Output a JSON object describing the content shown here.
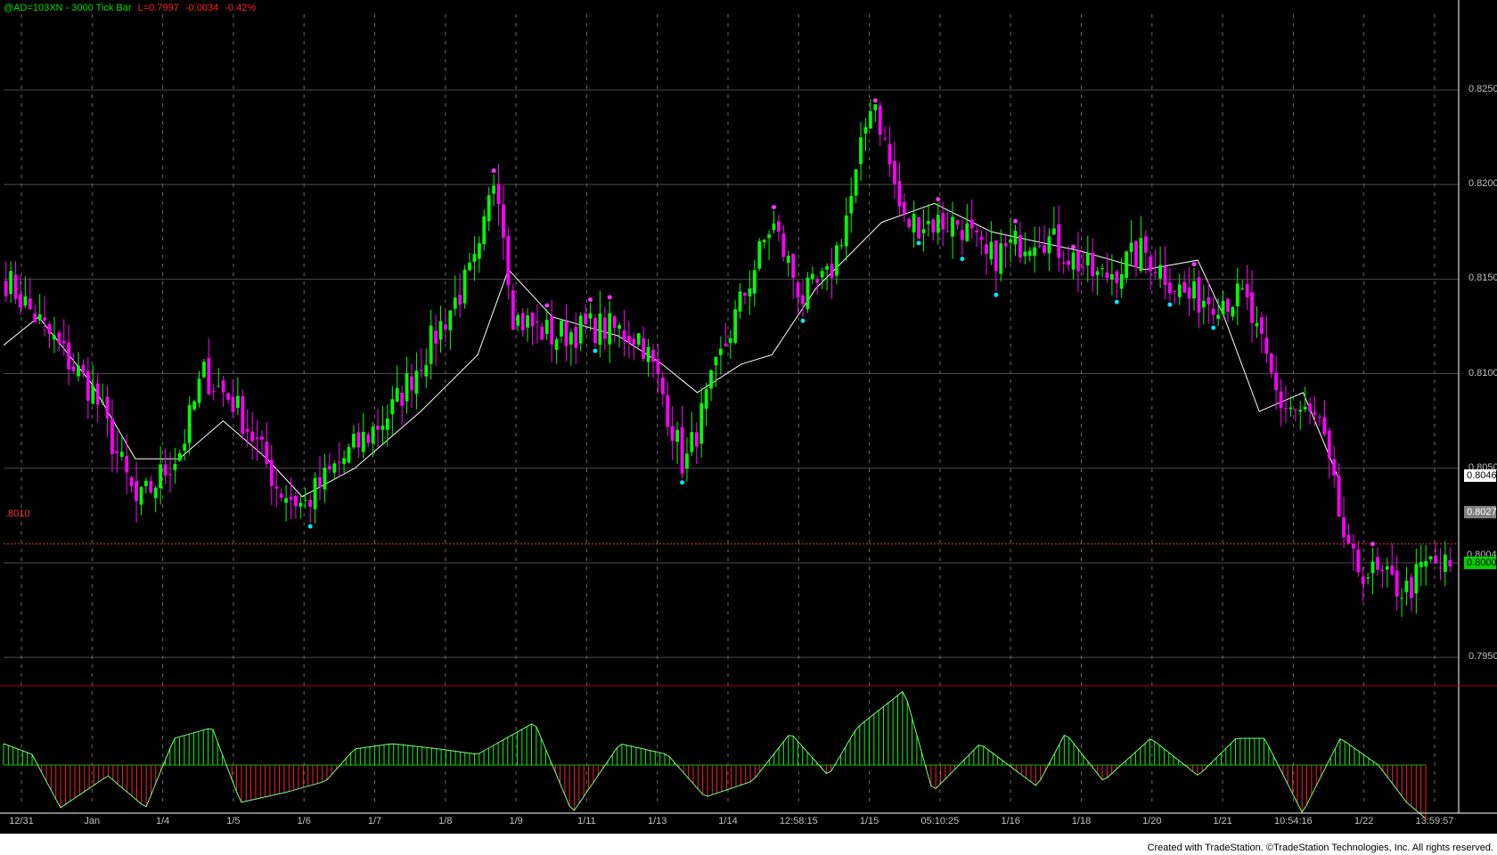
{
  "header": {
    "symbol": "@AD=103XN",
    "interval": "3000 Tick Bar",
    "last": "L=0.7997",
    "change": "-0.0034",
    "pct": "-0.42%"
  },
  "footer": "Created with TradeStation. ©TradeStation Technologies, Inc. All rights reserved.",
  "ref_line_label": ".8010",
  "price_tags": [
    {
      "text": "0.8046",
      "bg": "#ffffff",
      "fg": "#000000",
      "price": 0.8046
    },
    {
      "text": "0.8027",
      "bg": "#808080",
      "fg": "#ffffff",
      "price": 0.8027
    },
    {
      "text": "0.8004",
      "bg": "#000000",
      "fg": "#c0c0c0",
      "price": 0.8004
    },
    {
      "text": "0.8000",
      "bg": "#00d000",
      "fg": "#000000",
      "price": 0.8
    }
  ],
  "colors": {
    "up": "#00ff00",
    "down": "#ff00ff",
    "ma": "#ffffff",
    "high_dot": "#ff33ff",
    "low_dot": "#00e5ff",
    "osc_pos": "#00ff00",
    "osc_neg": "#ff2020",
    "grid": "#4a4a4a"
  },
  "chart_data": [
    {
      "type": "candlestick",
      "title": "@AD=103XN - 3000 Tick Bar",
      "ylabel": "",
      "ylim": [
        0.7935,
        0.829
      ],
      "y_ticks": [
        "0.8250",
        "0.8200",
        "0.8150",
        "0.8100",
        "0.8050",
        "0.7950"
      ],
      "y_tick_values": [
        0.825,
        0.82,
        0.815,
        0.81,
        0.805,
        0.795
      ],
      "x_tick_labels": [
        "12/31",
        "Jan",
        "1/4",
        "1/5",
        "1/6",
        "1/7",
        "1/8",
        "1/9",
        "1/11",
        "1/13",
        "1/14",
        "12:58:15",
        "1/15",
        "05:10:25",
        "1/16",
        "1/18",
        "1/20",
        "1/21",
        "10:54:16",
        "1/22",
        "13:59:57"
      ],
      "reference_line": 0.801,
      "bar_count": 300,
      "close_path": [
        [
          0,
          0.815
        ],
        [
          10,
          0.812
        ],
        [
          20,
          0.809
        ],
        [
          25,
          0.806
        ],
        [
          30,
          0.803
        ],
        [
          40,
          0.806
        ],
        [
          45,
          0.81
        ],
        [
          52,
          0.8085
        ],
        [
          58,
          0.806
        ],
        [
          62,
          0.804
        ],
        [
          68,
          0.803
        ],
        [
          75,
          0.805
        ],
        [
          88,
          0.808
        ],
        [
          98,
          0.812
        ],
        [
          108,
          0.816
        ],
        [
          112,
          0.821
        ],
        [
          116,
          0.813
        ],
        [
          125,
          0.812
        ],
        [
          135,
          0.8125
        ],
        [
          145,
          0.812
        ],
        [
          150,
          0.809
        ],
        [
          155,
          0.805
        ],
        [
          165,
          0.812
        ],
        [
          175,
          0.818
        ],
        [
          182,
          0.814
        ],
        [
          188,
          0.815
        ],
        [
          194,
          0.82
        ],
        [
          198,
          0.825
        ],
        [
          205,
          0.818
        ],
        [
          212,
          0.818
        ],
        [
          218,
          0.818
        ],
        [
          224,
          0.816
        ],
        [
          236,
          0.8175
        ],
        [
          250,
          0.815
        ],
        [
          260,
          0.8165
        ],
        [
          270,
          0.814
        ],
        [
          283,
          0.814
        ],
        [
          291,
          0.8085
        ],
        [
          300,
          0.8075
        ],
        [
          307,
          0.8
        ],
        [
          320,
          0.7985
        ],
        [
          325,
          0.8
        ],
        [
          330,
          0.7997
        ]
      ],
      "moving_average": [
        [
          0,
          0.8115
        ],
        [
          8,
          0.813
        ],
        [
          20,
          0.8095
        ],
        [
          30,
          0.8055
        ],
        [
          40,
          0.8055
        ],
        [
          50,
          0.8075
        ],
        [
          60,
          0.8055
        ],
        [
          68,
          0.8035
        ],
        [
          80,
          0.805
        ],
        [
          95,
          0.808
        ],
        [
          108,
          0.811
        ],
        [
          115,
          0.8155
        ],
        [
          125,
          0.813
        ],
        [
          140,
          0.812
        ],
        [
          150,
          0.8105
        ],
        [
          158,
          0.809
        ],
        [
          168,
          0.8105
        ],
        [
          175,
          0.811
        ],
        [
          185,
          0.8145
        ],
        [
          200,
          0.818
        ],
        [
          212,
          0.819
        ],
        [
          225,
          0.8175
        ],
        [
          245,
          0.8165
        ],
        [
          260,
          0.8155
        ],
        [
          272,
          0.816
        ],
        [
          278,
          0.813
        ],
        [
          286,
          0.808
        ],
        [
          296,
          0.809
        ],
        [
          304,
          0.8045
        ]
      ]
    },
    {
      "type": "histogram",
      "ylabel": "",
      "oscillator_path": [
        [
          0,
          0.4
        ],
        [
          6,
          0.2
        ],
        [
          12,
          -0.8
        ],
        [
          22,
          -0.2
        ],
        [
          30,
          -0.8
        ],
        [
          36,
          0.5
        ],
        [
          44,
          0.7
        ],
        [
          50,
          -0.7
        ],
        [
          60,
          -0.5
        ],
        [
          68,
          -0.3
        ],
        [
          74,
          0.3
        ],
        [
          82,
          0.4
        ],
        [
          92,
          0.3
        ],
        [
          100,
          0.2
        ],
        [
          112,
          0.8
        ],
        [
          120,
          -0.9
        ],
        [
          130,
          0.4
        ],
        [
          140,
          0.2
        ],
        [
          148,
          -0.6
        ],
        [
          158,
          -0.3
        ],
        [
          166,
          0.6
        ],
        [
          174,
          -0.2
        ],
        [
          180,
          0.7
        ],
        [
          190,
          1.4
        ],
        [
          196,
          -0.5
        ],
        [
          206,
          0.4
        ],
        [
          218,
          -0.4
        ],
        [
          224,
          0.6
        ],
        [
          232,
          -0.3
        ],
        [
          242,
          0.5
        ],
        [
          252,
          -0.2
        ],
        [
          260,
          0.5
        ],
        [
          266,
          0.5
        ],
        [
          274,
          -0.9
        ],
        [
          282,
          0.5
        ],
        [
          290,
          0.0
        ],
        [
          296,
          -0.7
        ],
        [
          300,
          -1.0
        ]
      ]
    }
  ]
}
